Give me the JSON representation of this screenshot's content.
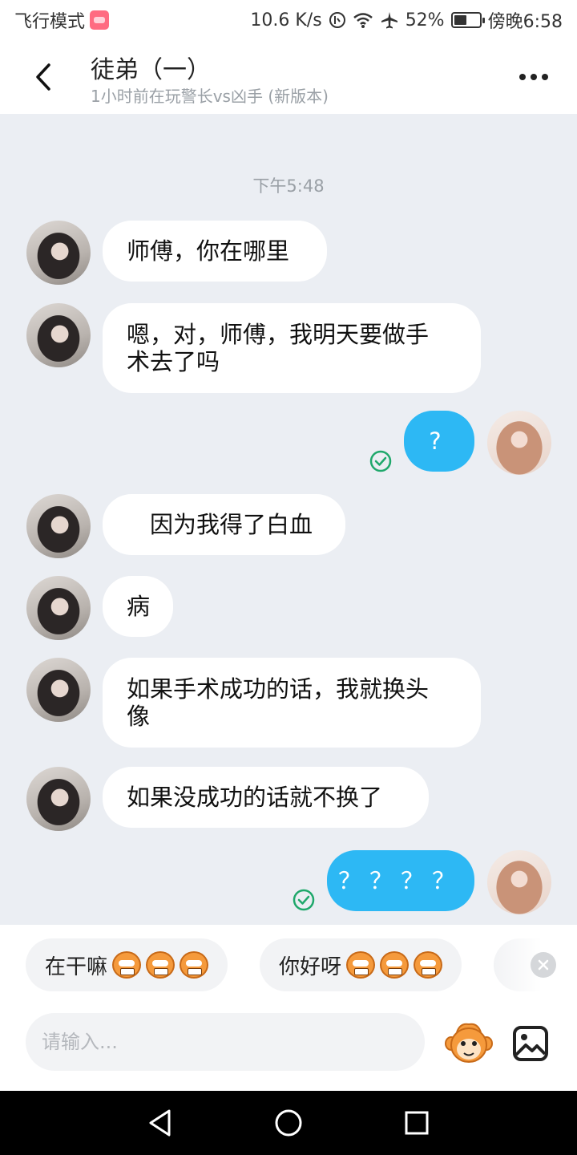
{
  "status_bar": {
    "mode_label": "飞行模式",
    "network_speed": "10.6 K/s",
    "battery_percent": "52%",
    "battery_level": 0.52,
    "time": "傍晚6:58"
  },
  "header": {
    "title": "徒弟（一）",
    "subtitle": "1小时前在玩警长vs凶手 (新版本)"
  },
  "chat": {
    "timestamp": "下午5:48",
    "messages": [
      {
        "side": "in",
        "lines": [
          "师傅，你在哪里"
        ]
      },
      {
        "side": "in",
        "lines": [
          "嗯，对，师傅，我明天要做手",
          "术去了吗"
        ]
      },
      {
        "side": "out",
        "lines": [
          "?"
        ],
        "read": true
      },
      {
        "side": "in",
        "lines": [
          "　因为我得了白血"
        ]
      },
      {
        "side": "in",
        "lines": [
          "病"
        ]
      },
      {
        "side": "in",
        "lines": [
          "如果手术成功的话，我就换头",
          "像"
        ]
      },
      {
        "side": "in",
        "lines": [
          "如果没成功的话就不换了"
        ]
      },
      {
        "side": "out",
        "lines": [
          "？？？？"
        ],
        "read": true
      }
    ]
  },
  "quick_replies": [
    {
      "label": "在干嘛",
      "emoji_count": 3
    },
    {
      "label": "你好呀",
      "emoji_count": 3
    }
  ],
  "input": {
    "placeholder": "请输入..."
  },
  "icons": {
    "back": "chevron-left-icon",
    "more": "more-dots-icon",
    "emoji": "monkey-emoji-icon",
    "image": "image-icon",
    "read": "check-circle-icon",
    "close": "close-icon",
    "nav_back": "triangle-back-icon",
    "nav_home": "circle-home-icon",
    "nav_recent": "square-recent-icon"
  },
  "colors": {
    "outgoing_bubble": "#2db8f4",
    "incoming_bubble": "#ffffff",
    "chat_background": "#ebeef3",
    "read_check": "#1fa86b"
  }
}
